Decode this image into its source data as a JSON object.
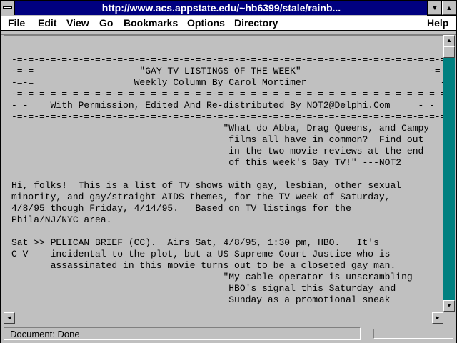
{
  "window": {
    "title": "http://www.acs.appstate.edu/~hb6399/stale/rainb..."
  },
  "titlebar_buttons": {
    "minimize_glyph": "▼",
    "maximize_glyph": "▲"
  },
  "menu": {
    "items": [
      "File",
      "Edit",
      "View",
      "Go",
      "Bookmarks",
      "Options",
      "Directory"
    ],
    "help": "Help"
  },
  "document": {
    "lines": [
      "-=-=-=-=-=-=-=-=-=-=-=-=-=-=-=-=-=-=-=-=-=-=-=-=-=-=-=-=-=-=-=-=-=-=-=-=-=-=-=-=-=-=-=-=-=-",
      "-=-=                   \"GAY TV LISTINGS OF THE WEEK\"                       -=-=",
      "-=-=                  Weekly Column By Carol Mortimer                        -=-=",
      "-=-=-=-=-=-=-=-=-=-=-=-=-=-=-=-=-=-=-=-=-=-=-=-=-=-=-=-=-=-=-=-=-=-=-=-=-=-=-=-=-=-=-=-=-=-",
      "-=-=   With Permission, Edited And Re-distributed By NOT2@Delphi.Com     -=-=",
      "-=-=-=-=-=-=-=-=-=-=-=-=-=-=-=-=-=-=-=-=-=-=-=-=-=-=-=-=-=-=-=-=-=-=-=-=-=-=-=-=-=-=-=-=-=-",
      "                                      \"What do Abba, Drag Queens, and Campy",
      "                                       films all have in common?  Find out",
      "                                       in the two movie reviews at the end",
      "                                       of this week's Gay TV!\" ---NOT2",
      "",
      "Hi, folks!  This is a list of TV shows with gay, lesbian, other sexual",
      "minority, and gay/straight AIDS themes, for the TV week of Saturday,",
      "4/8/95 though Friday, 4/14/95.   Based on TV listings for the",
      "Phila/NJ/NYC area.",
      "",
      "Sat >> PELICAN BRIEF (CC).  Airs Sat, 4/8/95, 1:30 pm, HBO.   It's",
      "C V    incidental to the plot, but a US Supreme Court Justice who is",
      "       assassinated in this movie turns out to be a closeted gay man.",
      "                                      \"My cable operator is unscrambling",
      "                                       HBO's signal this Saturday and",
      "                                       Sunday as a promotional sneak"
    ]
  },
  "scrollbars": {
    "up_glyph": "▲",
    "down_glyph": "▼",
    "left_glyph": "◄",
    "right_glyph": "►"
  },
  "status": {
    "text": "Document: Done"
  }
}
